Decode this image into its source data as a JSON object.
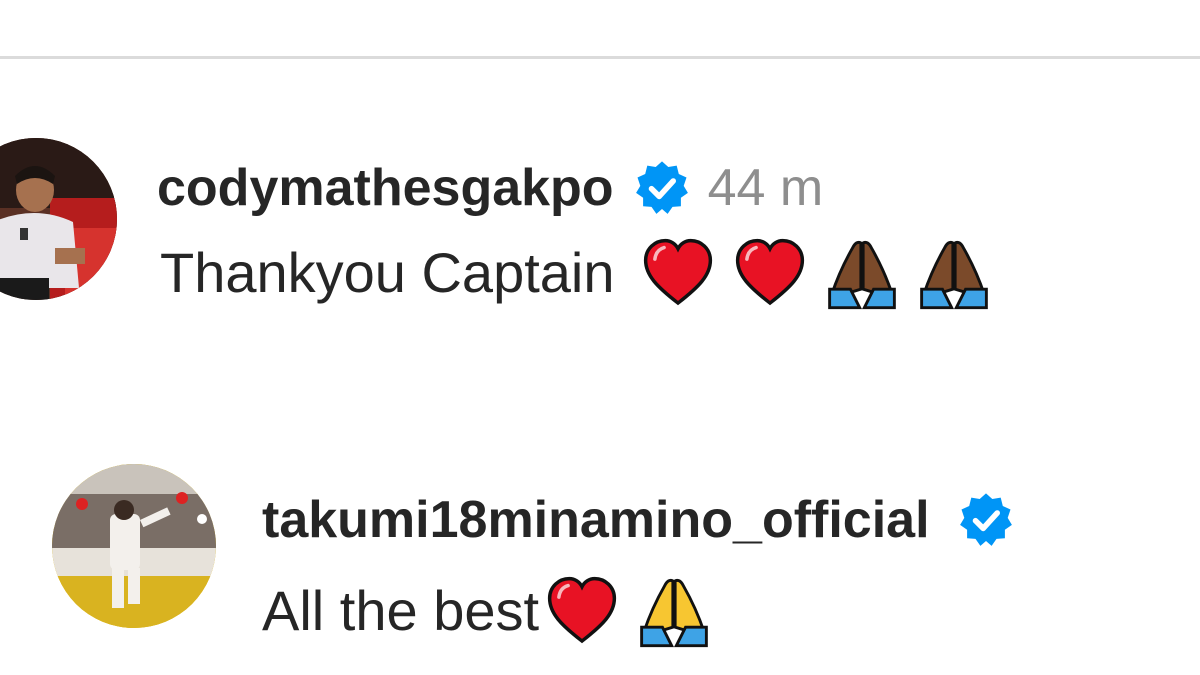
{
  "comments": [
    {
      "username": "codymathesgakpo",
      "verified": true,
      "time": "44 m",
      "text": "Thankyou Captain",
      "emojis": [
        "red-heart-icon",
        "red-heart-icon",
        "folded-hands-dark-icon",
        "folded-hands-dark-icon"
      ]
    },
    {
      "username": "takumi18minamino_official",
      "verified": true,
      "text": "All the best",
      "emojis": [
        "red-heart-icon",
        "folded-hands-light-icon"
      ]
    }
  ],
  "colors": {
    "verified_blue": "#0095f6",
    "heart_red": "#e81224",
    "text_primary": "#262626",
    "text_secondary": "#8e8e8e",
    "divider": "#dbdbdb"
  }
}
